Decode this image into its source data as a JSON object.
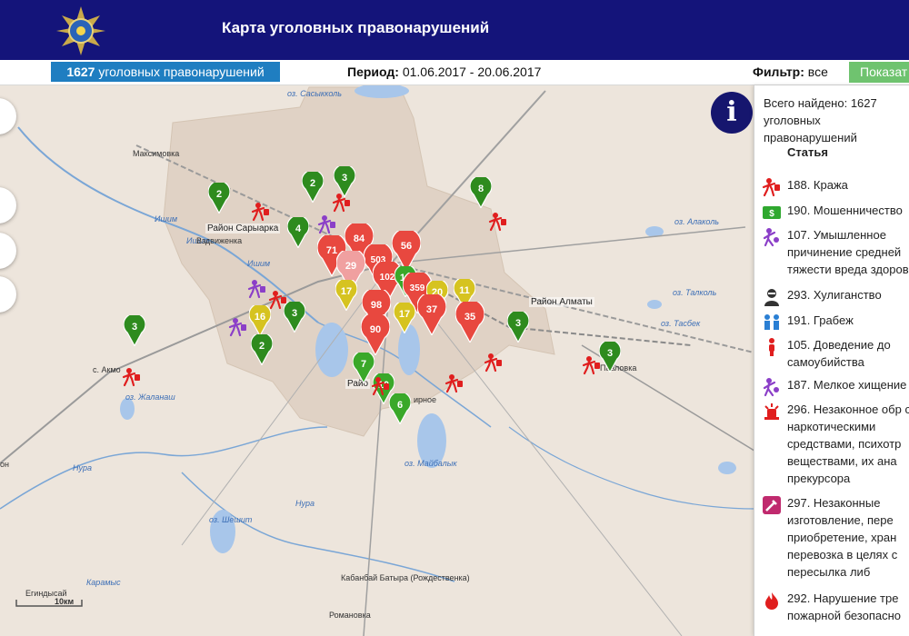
{
  "header": {
    "title": "Карта уголовных правонарушений"
  },
  "toolbar": {
    "count_value": "1627",
    "count_text": "уголовных правонарушений",
    "period_label": "Период:",
    "period_value": "01.06.2017 - 20.06.2017",
    "filter_label": "Фильтр:",
    "filter_value": "все",
    "show_button": "Показат"
  },
  "map": {
    "labels": {
      "lake_sasykkol": "оз. Сасыкколь",
      "maksimovka": "Максимовка",
      "ishim_1": "Ишим",
      "ishim_2": "Ишим",
      "ishim_3": "Ишим",
      "district_saryarka": "Район Сарыарка",
      "vozdvizhenka": "Вздвиженка",
      "lake_alakol": "оз. Алаколь",
      "district_almaty": "Район Алматы",
      "lake_talkol": "оз. Талколь",
      "lake_tasbek": "оз. Тасбек",
      "s_akmol": "с. Акмо",
      "lake_zhalanash": "оз. Жаланаш",
      "district_yesil": "Райо",
      "district_baikonyr": "ирное",
      "pavlovka": "Павловка",
      "lake_maibalyk": "оз. Майбалык",
      "nura_1": "Нура",
      "nura_2": "Нура",
      "lake_sheshit": "оз. Шешит",
      "kabanbai": "Кабанбай Батыра (Рождественка)",
      "romanovka": "Романовка",
      "yeginsay": "Егиндысай",
      "karamys": "Карамыс",
      "left_edge": "он",
      "scale": "10км"
    },
    "clusters": [
      {
        "n": "2",
        "c": "#2e8b1e"
      },
      {
        "n": "2",
        "c": "#2e8b1e"
      },
      {
        "n": "3",
        "c": "#2e8b1e"
      },
      {
        "n": "8",
        "c": "#2e8b1e"
      },
      {
        "n": "4",
        "c": "#2e8b1e"
      },
      {
        "n": "84",
        "c": "#e8483f"
      },
      {
        "n": "56",
        "c": "#e8483f"
      },
      {
        "n": "71",
        "c": "#e8483f"
      },
      {
        "n": "503",
        "c": "#e8483f"
      },
      {
        "n": "29",
        "c": "#f0a0a0"
      },
      {
        "n": "102",
        "c": "#e8483f"
      },
      {
        "n": "10",
        "c": "#3aa829"
      },
      {
        "n": "359",
        "c": "#e8483f"
      },
      {
        "n": "17",
        "c": "#d6c320"
      },
      {
        "n": "20",
        "c": "#d6c320"
      },
      {
        "n": "11",
        "c": "#d6c320"
      },
      {
        "n": "98",
        "c": "#e8483f"
      },
      {
        "n": "17",
        "c": "#d6c320"
      },
      {
        "n": "37",
        "c": "#e8483f"
      },
      {
        "n": "35",
        "c": "#e8483f"
      },
      {
        "n": "16",
        "c": "#d6c320"
      },
      {
        "n": "3",
        "c": "#2e8b1e"
      },
      {
        "n": "90",
        "c": "#e8483f"
      },
      {
        "n": "3",
        "c": "#2e8b1e"
      },
      {
        "n": "3",
        "c": "#2e8b1e"
      },
      {
        "n": "2",
        "c": "#2e8b1e"
      },
      {
        "n": "3",
        "c": "#2e8b1e"
      },
      {
        "n": "7",
        "c": "#3aa829"
      },
      {
        "n": "10",
        "c": "#3aa829"
      },
      {
        "n": "6",
        "c": "#3aa829"
      }
    ]
  },
  "info_button": "i",
  "legend": {
    "total": "Всего найдено: 1627 уголовных правонарушений",
    "heading": "Статья",
    "items": [
      {
        "icon": "theft-icon",
        "color": "#e01e1e",
        "text": "188. Кража"
      },
      {
        "icon": "fraud-icon",
        "color": "#2fa82f",
        "text": "190. Мошенничество"
      },
      {
        "icon": "assault-icon",
        "color": "#8b3fc8",
        "text": "107. Умышленное причинение средней тяжести вреда здоров"
      },
      {
        "icon": "hooligan-icon",
        "color": "#333333",
        "text": "293. Хулиганство"
      },
      {
        "icon": "robbery-icon",
        "color": "#2a7fd4",
        "text": "191. Грабеж"
      },
      {
        "icon": "suicide-icon",
        "color": "#e01e1e",
        "text": "105. Доведение до самоубийства"
      },
      {
        "icon": "petty-theft-icon",
        "color": "#8b3fc8",
        "text": "187. Мелкое хищение"
      },
      {
        "icon": "drugs-icon",
        "color": "#e01e1e",
        "text": "296. Незаконное обр с наркотическими средствами, психотр веществами, их ана прекурсора"
      },
      {
        "icon": "drug-production-icon",
        "color": "#c02a6e",
        "text": "297. Незаконные изготовление, пере приобретение, хран перевозка в целях с пересылка либ"
      },
      {
        "icon": "fire-icon",
        "color": "#e01e1e",
        "text": "292. Нарушение тре пожарной безопасно"
      }
    ]
  }
}
